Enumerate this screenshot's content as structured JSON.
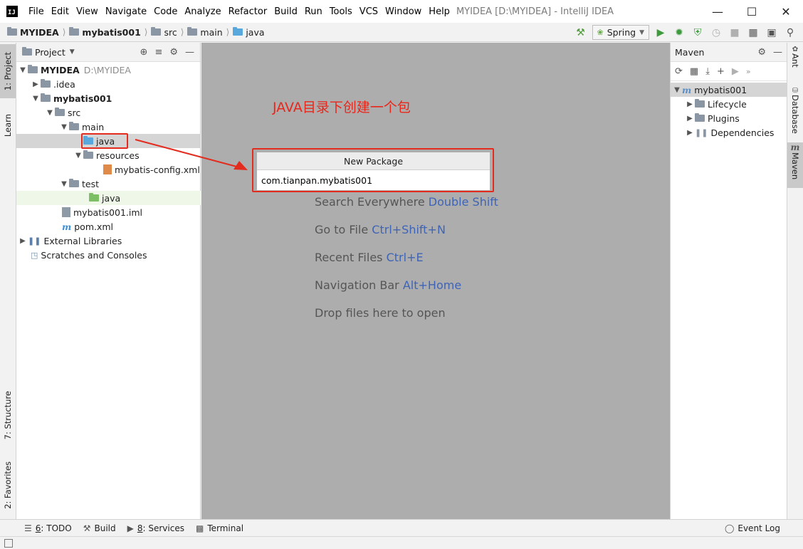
{
  "app": {
    "logo_text": "IJ",
    "window_title": "MYIDEA [D:\\MYIDEA] - IntelliJ IDEA",
    "menu": [
      "File",
      "Edit",
      "View",
      "Navigate",
      "Code",
      "Analyze",
      "Refactor",
      "Build",
      "Run",
      "Tools",
      "VCS",
      "Window",
      "Help"
    ]
  },
  "breadcrumb": [
    "MYIDEA",
    "mybatis001",
    "src",
    "main",
    "java"
  ],
  "run_config": {
    "label": "Spring"
  },
  "left_stripe": {
    "project": "1: Project",
    "learn": "Learn",
    "structure": "7: Structure",
    "favorites": "2: Favorites"
  },
  "project_panel": {
    "title": "Project",
    "tree": [
      {
        "label": "MYIDEA",
        "extra": "D:\\MYIDEA"
      },
      {
        "label": ".idea"
      },
      {
        "label": "mybatis001"
      },
      {
        "label": "src"
      },
      {
        "label": "main"
      },
      {
        "label": "java"
      },
      {
        "label": "resources"
      },
      {
        "label": "mybatis-config.xml"
      },
      {
        "label": "test"
      },
      {
        "label": "java"
      },
      {
        "label": "mybatis001.iml"
      },
      {
        "label": "pom.xml"
      },
      {
        "label": "External Libraries"
      },
      {
        "label": "Scratches and Consoles"
      }
    ]
  },
  "editor": {
    "annotation": "JAVA目录下创建一个包",
    "hints": [
      {
        "text": "Search Everywhere",
        "shortcut": "Double Shift"
      },
      {
        "text": "Go to File",
        "shortcut": "Ctrl+Shift+N"
      },
      {
        "text": "Recent Files",
        "shortcut": "Ctrl+E"
      },
      {
        "text": "Navigation Bar",
        "shortcut": "Alt+Home"
      },
      {
        "text": "Drop files here to open",
        "shortcut": ""
      }
    ]
  },
  "new_package": {
    "title": "New Package",
    "value": "com.tianpan.mybatis001"
  },
  "maven": {
    "title": "Maven",
    "tree": [
      {
        "label": "mybatis001"
      },
      {
        "label": "Lifecycle"
      },
      {
        "label": "Plugins"
      },
      {
        "label": "Dependencies"
      }
    ]
  },
  "right_stripe": {
    "ant": "Ant",
    "database": "Database",
    "maven": "Maven",
    "maven_glyph": "m"
  },
  "bottom_tabs": [
    {
      "key": "6",
      "label": ": TODO"
    },
    {
      "key": "",
      "label": "Build"
    },
    {
      "key": "8",
      "label": ": Services"
    },
    {
      "key": "",
      "label": "Terminal"
    }
  ],
  "event_log": "Event Log",
  "colors": {
    "annotation_red": "#e8261a",
    "shortcut_blue": "#3f64b4",
    "editor_bg": "#adadad",
    "folder_blue": "#59a8dd",
    "folder_green": "#7dbf65"
  }
}
